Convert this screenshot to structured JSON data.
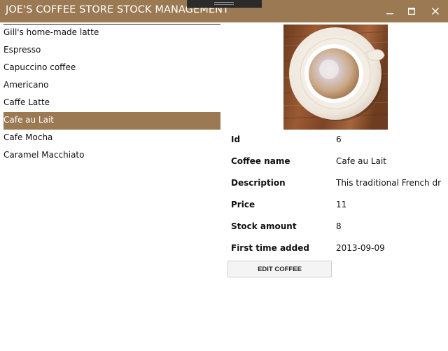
{
  "window": {
    "title": "JOE'S COFFEE STORE STOCK MANAGEMENT",
    "accent_color": "#9b7a53"
  },
  "coffee_list": {
    "items": [
      "Gill's home-made latte",
      "Espresso",
      "Capuccino coffee",
      "Americano",
      "Caffe Latte",
      "Cafe au Lait",
      "Cafe Mocha",
      "Caramel Macchiato"
    ],
    "selected_index": 5
  },
  "detail": {
    "image_icon": "coffee-cup-photo",
    "fields": [
      {
        "label": "Id",
        "value": "6"
      },
      {
        "label": "Coffee name",
        "value": "Cafe au Lait"
      },
      {
        "label": "Description",
        "value": "This traditional French drink"
      },
      {
        "label": "Price",
        "value": "11"
      },
      {
        "label": "Stock amount",
        "value": "8"
      },
      {
        "label": "First time added",
        "value": "2013-09-09"
      }
    ],
    "edit_button_label": "EDIT COFFEE"
  }
}
